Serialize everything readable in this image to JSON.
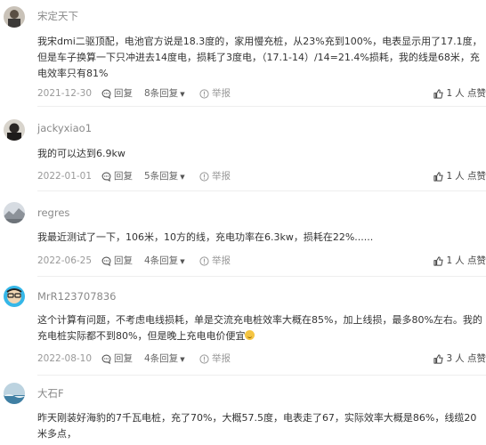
{
  "ui": {
    "reply_label": "回复",
    "report_label": "举报",
    "like_suffix": "人 点赞",
    "accent_color": "#333333",
    "muted_color": "#999999"
  },
  "comments": [
    {
      "username": "宋定天下",
      "content": "我宋dmi二驱顶配，电池官方说是18.3度的，家用慢充桩，从23%充到100%，电表显示用了17.1度，但是车子换算一下只冲进去14度电，损耗了3度电，（17.1-14）/14=21.4%损耗，我的线是68米，充电效率只有81%",
      "date": "2021-12-30",
      "replies": "8条回复",
      "likes": "1"
    },
    {
      "username": "jackyxiao1",
      "content": "我的可以达到6.9kw",
      "date": "2022-01-01",
      "replies": "5条回复",
      "likes": "1"
    },
    {
      "username": "regres",
      "content": "我最近测试了一下，106米，10方的线，充电功率在6.3kw，损耗在22%......",
      "date": "2022-06-25",
      "replies": "4条回复",
      "likes": "1"
    },
    {
      "username": "MrR123707836",
      "content": "这个计算有问题，不考虑电线损耗，单是交流充电桩效率大概在85%，加上线损，最多80%左右。我的充电桩实际都不到80%，但是晚上充电电价便宜",
      "date": "2022-08-10",
      "replies": "4条回复",
      "likes": "3"
    },
    {
      "username": "大石F",
      "content": "昨天刚装好海豹的7千瓦电桩，充了70%，大概57.5度，电表走了67，实际效率大概是86%，线缆20米多点，"
    }
  ]
}
